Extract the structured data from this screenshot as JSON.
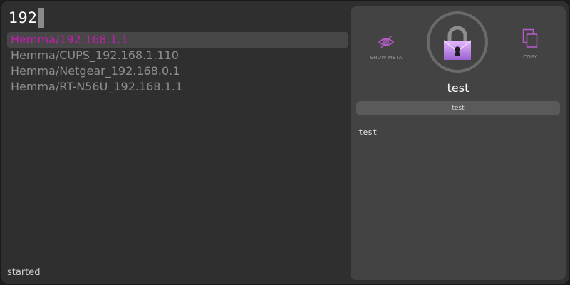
{
  "search": {
    "query": "192"
  },
  "results": [
    {
      "label": "Hemma/192.168.1.1",
      "selected": true
    },
    {
      "label": "Hemma/CUPS_192.168.1.110",
      "selected": false
    },
    {
      "label": "Hemma/Netgear_192.168.0.1",
      "selected": false
    },
    {
      "label": "Hemma/RT-N56U_192.168.1.1",
      "selected": false
    }
  ],
  "status": "started",
  "detail": {
    "show_meta_label": "SHOW META",
    "show_meta_icon": "eye-slash-icon",
    "copy_label": "COPY",
    "copy_icon": "copy-icon",
    "lock_icon": "lock-envelope-icon",
    "title": "test",
    "password": "test",
    "notes": "test"
  },
  "colors": {
    "accent": "#c21fb0",
    "icon_purple": "#b45cc6",
    "lock_gradient_top": "#e6b8ff",
    "lock_gradient_bottom": "#9a62d2"
  }
}
